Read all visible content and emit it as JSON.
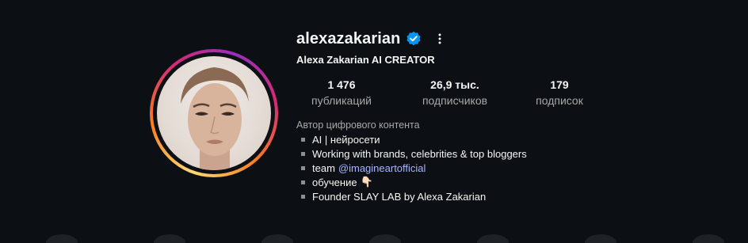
{
  "profile": {
    "username": "alexazakarian",
    "full_name": "Alexa Zakarian AI CREATOR",
    "verified": true,
    "verified_icon": "verified-badge-icon",
    "more_icon": "more-options-icon"
  },
  "stats": {
    "posts": {
      "value": "1 476",
      "label": "публикаций"
    },
    "followers": {
      "value": "26,9 тыс.",
      "label": "подписчиков"
    },
    "following": {
      "value": "179",
      "label": "подписок"
    }
  },
  "bio": {
    "category": "Автор цифрового контента",
    "lines": [
      {
        "text": "AI | нейросети"
      },
      {
        "text": "Working with brands, celebrities & top bloggers"
      },
      {
        "text": "team",
        "mention": "@imagineartofficial"
      },
      {
        "text": "обучение",
        "emoji": "👇🏻"
      },
      {
        "text": "Founder SLAY LAB by Alexa Zakarian"
      }
    ]
  },
  "colors": {
    "background": "#0c1014",
    "text_primary": "#f5f5f5",
    "text_secondary": "#a8a8a8",
    "mention": "#a6b5ff",
    "verified": "#0095f6"
  }
}
